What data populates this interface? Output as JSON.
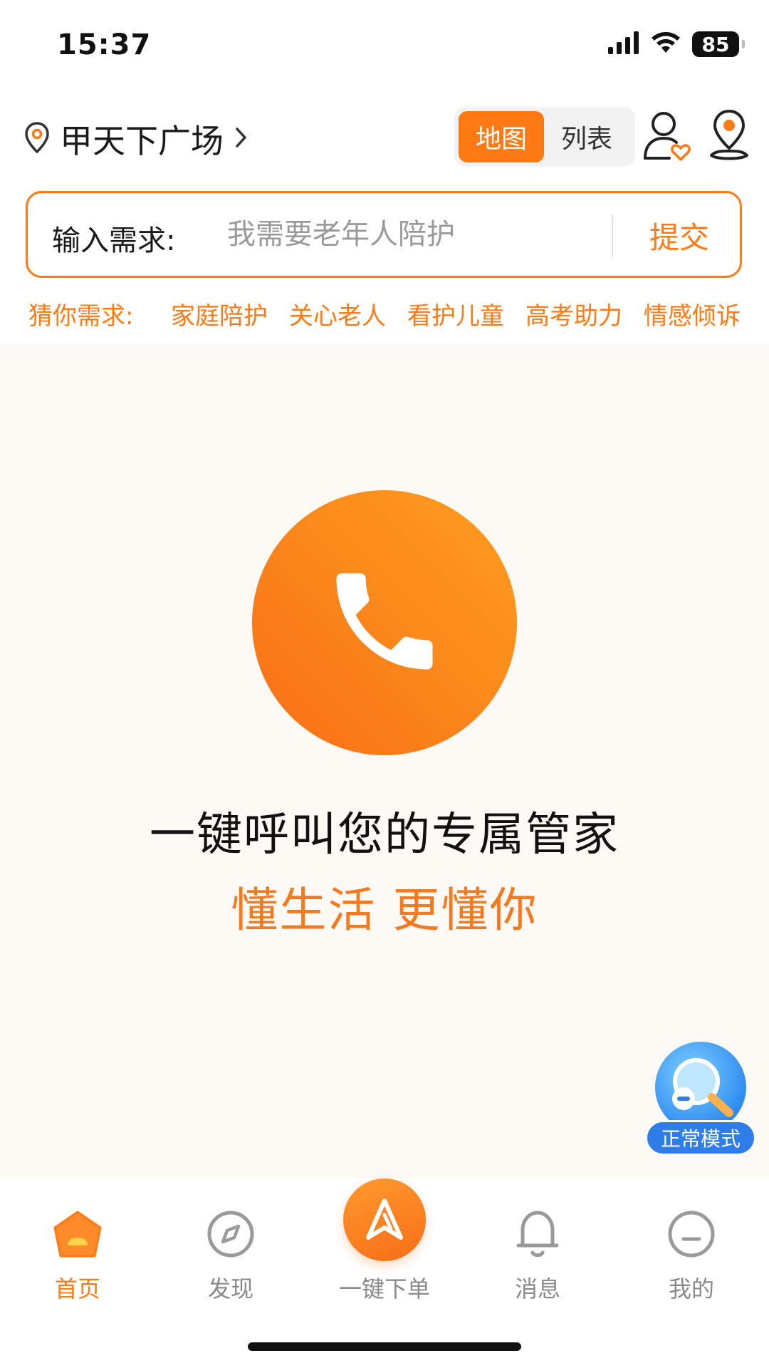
{
  "status_bar": {
    "time": "15:37",
    "battery": "85"
  },
  "header": {
    "location": "甲天下广场",
    "view_toggle": {
      "map": "地图",
      "list": "列表",
      "selected": "地图"
    }
  },
  "search": {
    "label": "输入需求:",
    "placeholder": "我需要老年人陪护",
    "submit": "提交"
  },
  "suggestions": {
    "label": "猜你需求:",
    "items": [
      "家庭陪护",
      "关心老人",
      "看护儿童",
      "高考助力",
      "情感倾诉"
    ]
  },
  "main": {
    "title": "一键呼叫您的专属管家",
    "slogan": "懂生活 更懂你"
  },
  "mode_button": {
    "label": "正常模式"
  },
  "tabbar": {
    "items": [
      {
        "label": "首页",
        "icon": "home-icon",
        "active": true
      },
      {
        "label": "发现",
        "icon": "compass-icon",
        "active": false
      },
      {
        "label": "一键下单",
        "icon": "quick-order-icon",
        "active": false
      },
      {
        "label": "消息",
        "icon": "bell-icon",
        "active": false
      },
      {
        "label": "我的",
        "icon": "profile-icon",
        "active": false
      }
    ]
  },
  "colors": {
    "accent": "#ff7a12",
    "background": "#fdf9f4",
    "mode_blue": "#2e7de8"
  }
}
